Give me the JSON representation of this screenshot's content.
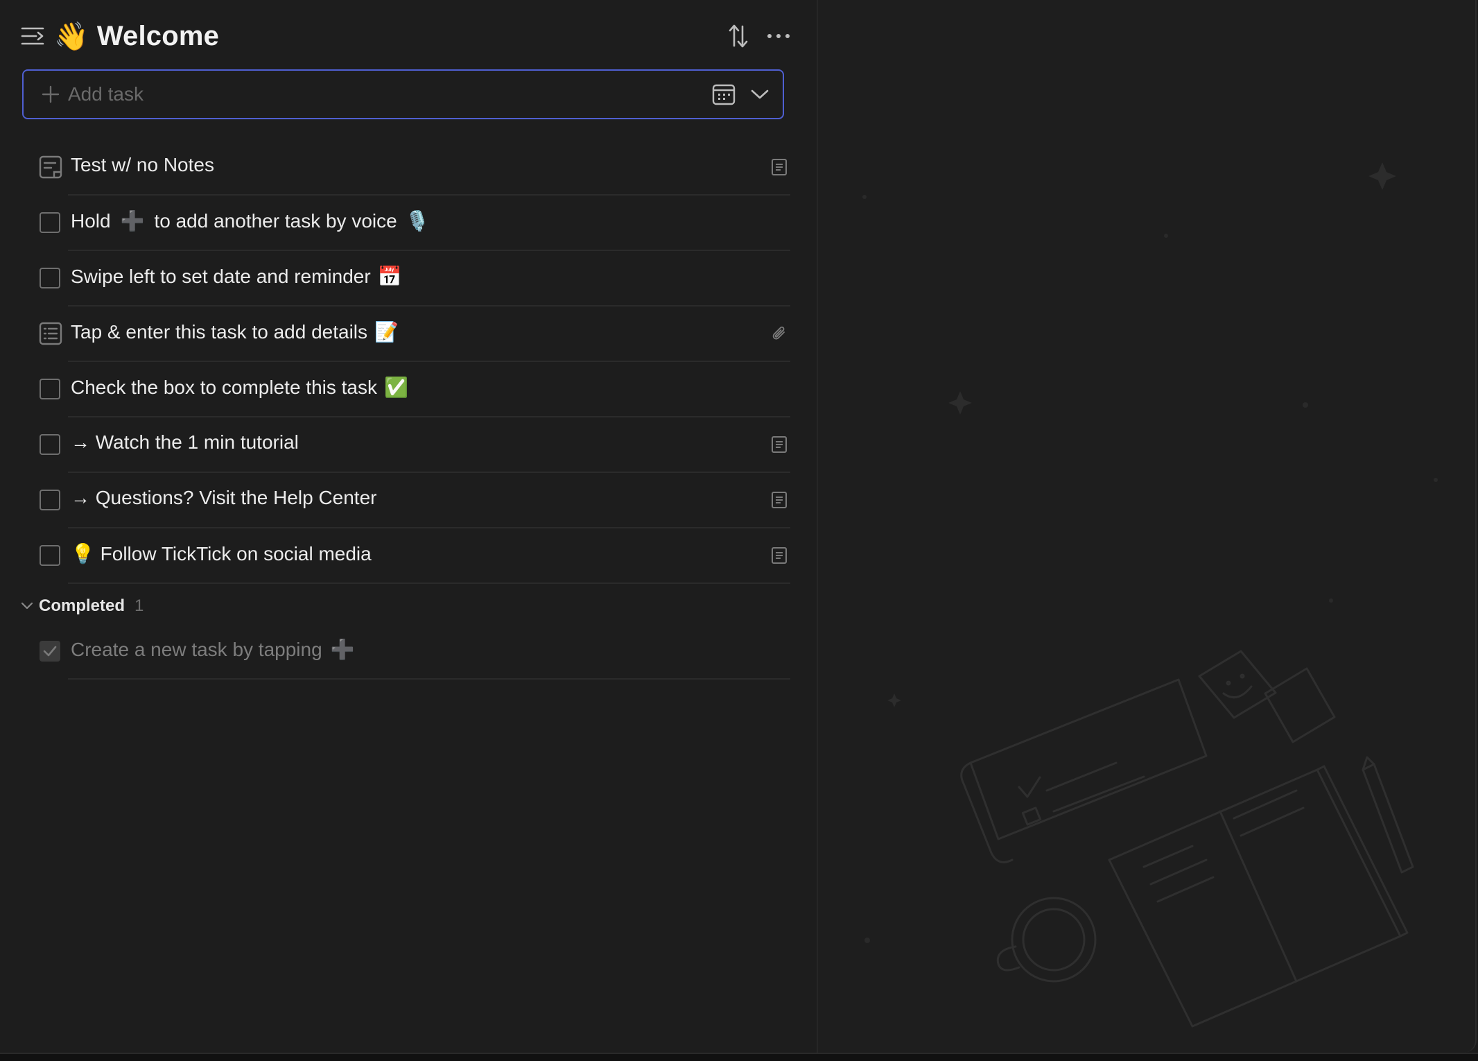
{
  "header": {
    "title": "Welcome",
    "title_emoji": "👋"
  },
  "add_task": {
    "placeholder": "Add task"
  },
  "tasks": [
    {
      "text": "Test w/ no Notes",
      "suffix": "",
      "kind": "note",
      "trail": "note-icon"
    },
    {
      "text": "Hold",
      "mid_glyph": "➕",
      "text2": "to add another task by voice",
      "suffix": "🎙️",
      "kind": "checkbox",
      "trail": ""
    },
    {
      "text": "Swipe left to set date and reminder",
      "suffix": "📅",
      "kind": "checkbox",
      "trail": ""
    },
    {
      "text": "Tap & enter this task to add details",
      "suffix": "📝",
      "kind": "list",
      "trail": "attachment-icon"
    },
    {
      "text": "Check the box to complete this task",
      "suffix": "✅",
      "kind": "checkbox",
      "trail": ""
    },
    {
      "text": "→ Watch the 1 min tutorial",
      "suffix": "",
      "kind": "checkbox",
      "trail": "note-icon"
    },
    {
      "text": "→ Questions? Visit the Help Center",
      "suffix": "",
      "kind": "checkbox",
      "trail": "note-icon"
    },
    {
      "text": "💡  Follow TickTick on social media",
      "suffix": "",
      "kind": "checkbox",
      "trail": "note-icon"
    }
  ],
  "completed": {
    "label": "Completed",
    "count": "1",
    "items": [
      {
        "text": "Create a new task by tapping",
        "suffix": "➕"
      }
    ]
  },
  "colors": {
    "accent": "#4f5fd1",
    "background": "#1d1d1d"
  }
}
